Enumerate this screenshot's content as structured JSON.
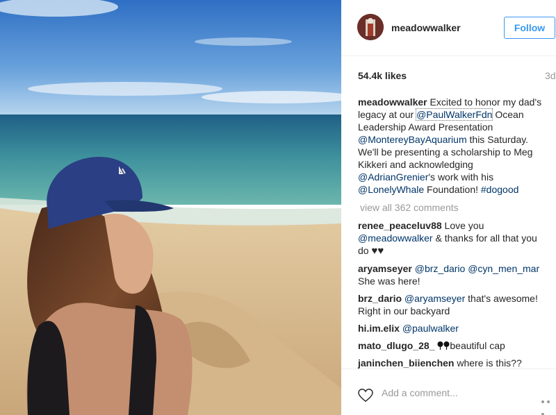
{
  "post": {
    "username": "meadowwalker",
    "follow_label": "Follow",
    "likes": "54.4k likes",
    "time_ago": "3d",
    "caption": {
      "username": "meadowwalker",
      "t1": " Excited to honor my dad's legacy at our ",
      "m1": "@PaulWalkerFdn",
      "t2": " Ocean Leadership Award Presentation ",
      "m2": "@MontereyBayAquarium",
      "t3": " this Saturday. We'll be presenting a scholarship to Meg Kikkeri and acknowledging ",
      "m3": "@AdrianGrenier",
      "t4": "'s work with his ",
      "m4": "@LonelyWhale",
      "t5": " Foundation! ",
      "m5": "#dogood"
    },
    "view_all": "view all 362 comments",
    "comments": [
      {
        "username": "renee_peaceluv88",
        "t1": " Love you ",
        "m1": "@meadowwalker",
        "t2": " & thanks for all that you do ",
        "emoji": "♥♥"
      },
      {
        "username": "aryamseyer",
        "m1": "@brz_dario",
        "m2": "@cyn_men_mar",
        "t1": " She was here!"
      },
      {
        "username": "brz_dario",
        "m1": "@aryamseyer",
        "t1": " that's awesome! Right in our backyard"
      },
      {
        "username": "hi.im.elix",
        "m1": "@paulwalker"
      },
      {
        "username": "mato_dlugo_28_",
        "t1": "beautiful cap"
      },
      {
        "username": "janinchen_biienchen",
        "t1": " where is this??"
      }
    ],
    "add_comment_placeholder": "Add a comment...",
    "icons": {
      "like": "heart-outline-icon",
      "more": "more-options-icon",
      "pin": "pin-emoji-icon"
    },
    "colors": {
      "link": "#003569",
      "follow": "#3897f0",
      "muted": "#999999"
    }
  }
}
